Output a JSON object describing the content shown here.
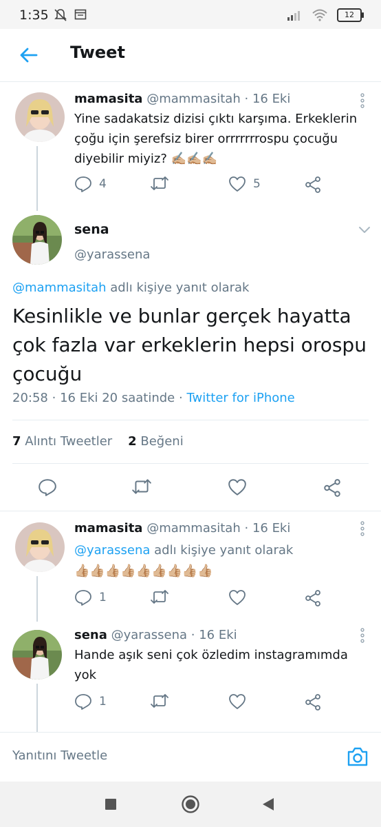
{
  "status_bar": {
    "time": "1:35",
    "battery": "12"
  },
  "header": {
    "title": "Tweet"
  },
  "parent_tweet": {
    "name": "mamasita",
    "handle": "@mammasitah",
    "dot": "·",
    "date": "16 Eki",
    "text": "Yine sadakatsiz dizisi çıktı karşıma. Erkeklerin çoğu için şerefsiz birer orrrrrrrospu çocuğu diyebilir miyiz? ✍🏼✍🏼✍🏼",
    "reply_count": "4",
    "like_count": "5"
  },
  "main_tweet": {
    "name": "sena",
    "handle": "@yarassena",
    "reply_to_handle": "@mammasitah",
    "reply_to_suffix": " adlı kişiye yanıt olarak",
    "text": "Kesinlikle ve bunlar gerçek hayatta çok fazla var erkeklerin hepsi orospu çocuğu",
    "time": "20:58",
    "date": "16 Eki 20 saatinde",
    "dot": "·",
    "source": "Twitter for iPhone",
    "quote_count": "7",
    "quote_label": "Alıntı Tweetler",
    "like_count": "2",
    "like_label": "Beğeni"
  },
  "replies": [
    {
      "name": "mamasita",
      "handle": "@mammasitah",
      "dot": "·",
      "date": "16 Eki",
      "reply_to_handle": "@yarassena",
      "reply_to_suffix": " adlı kişiye yanıt olarak",
      "text": "👍🏼👍🏼👍🏼👍🏼👍🏼👍🏼👍🏼👍🏼👍🏼",
      "reply_count": "1"
    },
    {
      "name": "sena",
      "handle": "@yarassena",
      "dot": "·",
      "date": "16 Eki",
      "text": "Hande aşık seni çok özledim instagramımda yok",
      "reply_count": "1"
    }
  ],
  "reply_bar": {
    "placeholder": "Yanıtını Tweetle"
  },
  "colors": {
    "accent": "#1da1f2",
    "muted": "#657786",
    "text": "#14171a"
  }
}
